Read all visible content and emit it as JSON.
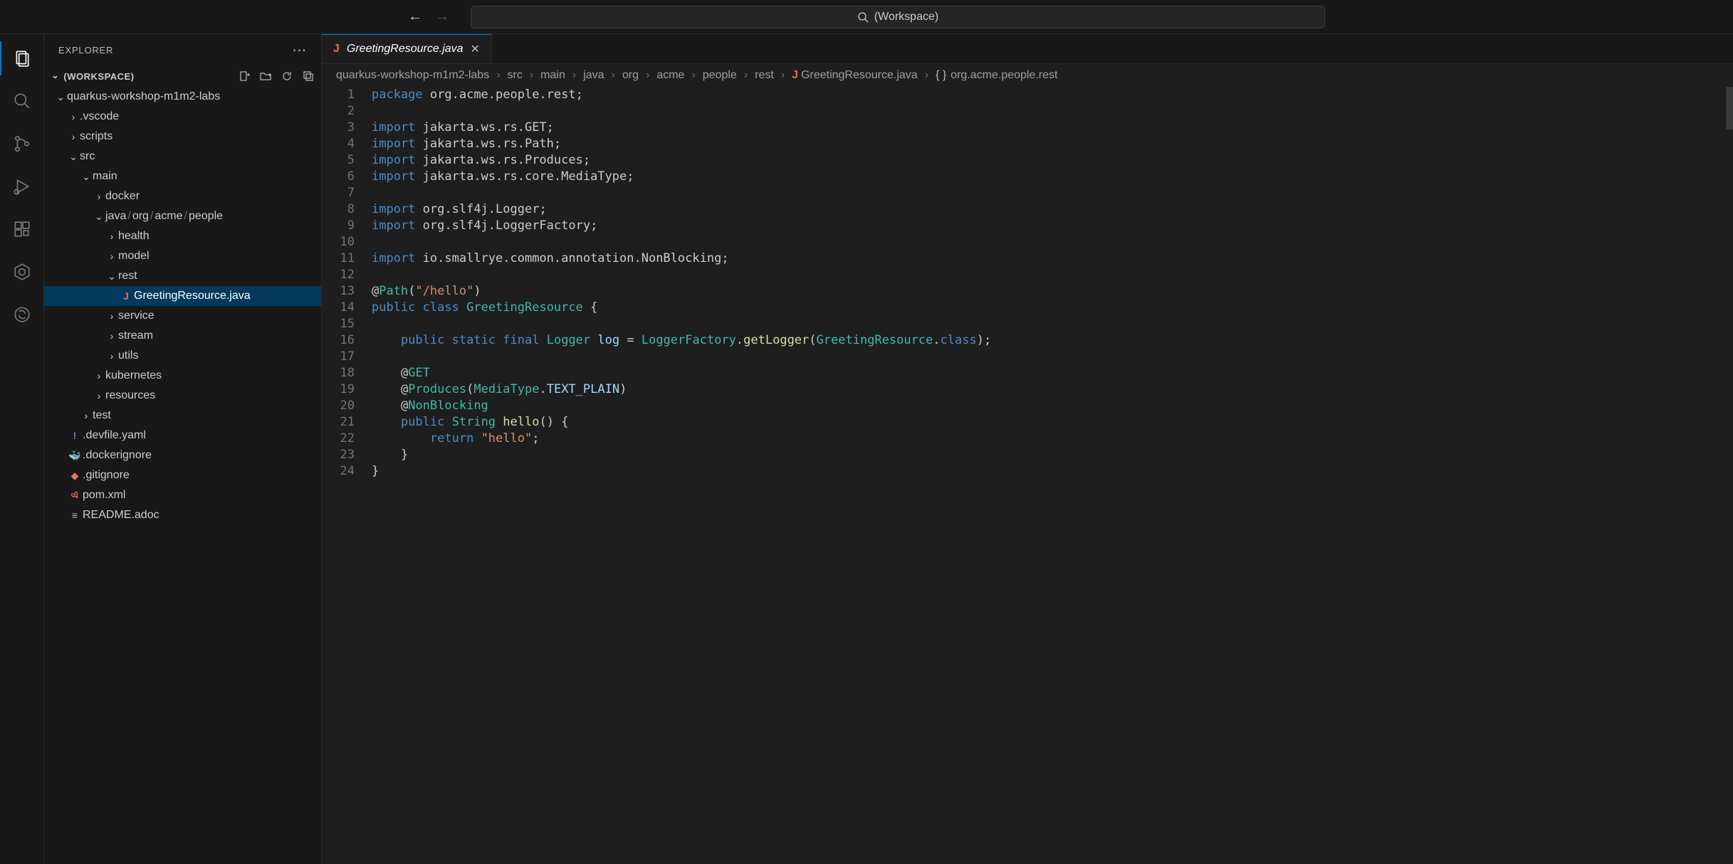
{
  "titlebar": {
    "search_placeholder": "(Workspace)"
  },
  "activity": {
    "items": [
      "files-icon",
      "search-icon",
      "source-control-icon",
      "run-debug-icon",
      "extensions-icon",
      "kubernetes-icon",
      "remote-icon"
    ]
  },
  "sidebar": {
    "title": "EXPLORER",
    "section": "(WORKSPACE)",
    "tree": [
      {
        "indent": 0,
        "twisty": "down",
        "label": "quarkus-workshop-m1m2-labs"
      },
      {
        "indent": 1,
        "twisty": "right",
        "label": ".vscode"
      },
      {
        "indent": 1,
        "twisty": "right",
        "label": "scripts"
      },
      {
        "indent": 1,
        "twisty": "down",
        "label": "src"
      },
      {
        "indent": 2,
        "twisty": "down",
        "label": "main"
      },
      {
        "indent": 3,
        "twisty": "right",
        "label": "docker"
      },
      {
        "indent": 3,
        "twisty": "down",
        "label_html": "java<span class='path-sep'>/</span>org<span class='path-sep'>/</span>acme<span class='path-sep'>/</span>people"
      },
      {
        "indent": 4,
        "twisty": "right",
        "label": "health"
      },
      {
        "indent": 4,
        "twisty": "right",
        "label": "model"
      },
      {
        "indent": 4,
        "twisty": "down",
        "label": "rest"
      },
      {
        "indent": 5,
        "icon": "java",
        "label": "GreetingResource.java",
        "selected": true
      },
      {
        "indent": 4,
        "twisty": "right",
        "label": "service"
      },
      {
        "indent": 4,
        "twisty": "right",
        "label": "stream"
      },
      {
        "indent": 4,
        "twisty": "right",
        "label": "utils"
      },
      {
        "indent": 3,
        "twisty": "right",
        "label": "kubernetes"
      },
      {
        "indent": 3,
        "twisty": "right",
        "label": "resources"
      },
      {
        "indent": 2,
        "twisty": "right",
        "label": "test"
      },
      {
        "indent": 1,
        "icon": "yaml",
        "label": ".devfile.yaml"
      },
      {
        "indent": 1,
        "icon": "docker",
        "label": ".dockerignore"
      },
      {
        "indent": 1,
        "icon": "git",
        "label": ".gitignore"
      },
      {
        "indent": 1,
        "icon": "xml",
        "label": "pom.xml"
      },
      {
        "indent": 1,
        "icon": "readme",
        "label": "README.adoc"
      }
    ]
  },
  "tabs": [
    {
      "icon": "java",
      "label": "GreetingResource.java"
    }
  ],
  "breadcrumb": [
    {
      "label": "quarkus-workshop-m1m2-labs"
    },
    {
      "label": "src"
    },
    {
      "label": "main"
    },
    {
      "label": "java"
    },
    {
      "label": "org"
    },
    {
      "label": "acme"
    },
    {
      "label": "people"
    },
    {
      "label": "rest"
    },
    {
      "icon": "java",
      "label": "GreetingResource.java"
    },
    {
      "icon": "bracket",
      "label": "org.acme.people.rest"
    }
  ],
  "code": {
    "lines": [
      "<span class='tok-kw'>package</span> <span class='tok-pkg'>org.acme.people.rest</span>;",
      "",
      "<span class='tok-kw'>import</span> <span class='tok-pkg'>jakarta.ws.rs.GET</span>;",
      "<span class='tok-kw'>import</span> <span class='tok-pkg'>jakarta.ws.rs.Path</span>;",
      "<span class='tok-kw'>import</span> <span class='tok-pkg'>jakarta.ws.rs.Produces</span>;",
      "<span class='tok-kw'>import</span> <span class='tok-pkg'>jakarta.ws.rs.core.MediaType</span>;",
      "",
      "<span class='tok-kw'>import</span> <span class='tok-pkg'>org.slf4j.Logger</span>;",
      "<span class='tok-kw'>import</span> <span class='tok-pkg'>org.slf4j.LoggerFactory</span>;",
      "",
      "<span class='tok-kw'>import</span> <span class='tok-pkg'>io.smallrye.common.annotation.NonBlocking</span>;",
      "",
      "<span class='tok-at'>@</span><span class='tok-ann'>Path</span>(<span class='tok-str'>\"/hello\"</span>)",
      "<span class='tok-kw'>public</span> <span class='tok-kw'>class</span> <span class='tok-type'>GreetingResource</span> {",
      "",
      "    <span class='tok-kw'>public</span> <span class='tok-kw'>static</span> <span class='tok-kw'>final</span> <span class='tok-type'>Logger</span> <span class='tok-var'>log</span> = <span class='tok-type'>LoggerFactory</span>.<span class='tok-fn'>getLogger</span>(<span class='tok-type'>GreetingResource</span>.<span class='tok-kw'>class</span>);",
      "",
      "    <span class='tok-at'>@</span><span class='tok-ann'>GET</span>",
      "    <span class='tok-at'>@</span><span class='tok-ann'>Produces</span>(<span class='tok-type'>MediaType</span>.<span class='tok-var'>TEXT_PLAIN</span>)",
      "    <span class='tok-at'>@</span><span class='tok-ann'>NonBlocking</span>",
      "    <span class='tok-kw'>public</span> <span class='tok-type'>String</span> <span class='tok-fn'>hello</span>() {",
      "        <span class='tok-kw'>return</span> <span class='tok-str'>\"hello\"</span>;",
      "    }",
      "}"
    ]
  }
}
